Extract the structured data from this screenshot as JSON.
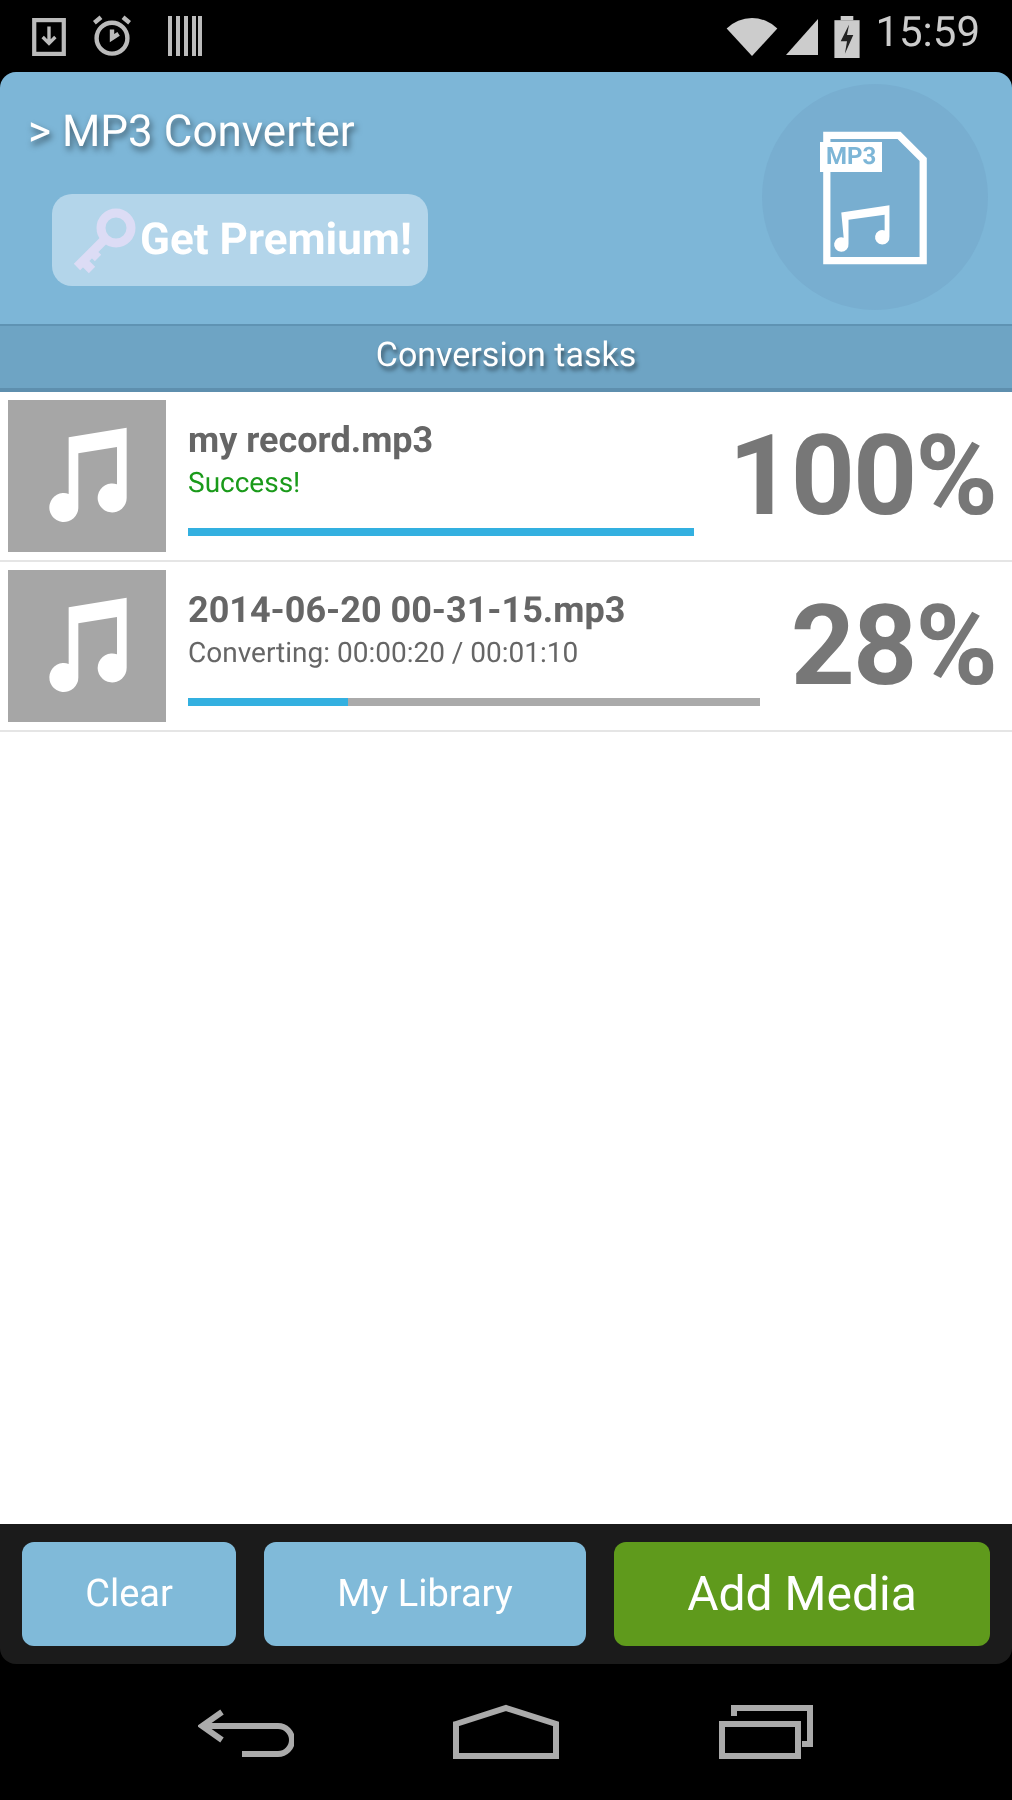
{
  "status_bar": {
    "time": "15:59"
  },
  "header": {
    "title": "> MP3 Converter",
    "premium_button": "Get Premium!",
    "logo_label": "MP3"
  },
  "section_title": "Conversion tasks",
  "tasks": [
    {
      "name": "my record.mp3",
      "status": "Success!",
      "kind": "done",
      "level": 1,
      "percent": "100%"
    },
    {
      "name": "2014-06-20 00-31-15.mp3",
      "status": "Converting: 00:00:20 / 00:01:10",
      "kind": "converting",
      "level": 0.28,
      "percent": "28%"
    }
  ],
  "buttons": [
    {
      "label": "Clear",
      "kind": "secondary"
    },
    {
      "label": "My Library",
      "kind": "secondary"
    },
    {
      "label": "Add Media",
      "kind": "primary"
    }
  ]
}
